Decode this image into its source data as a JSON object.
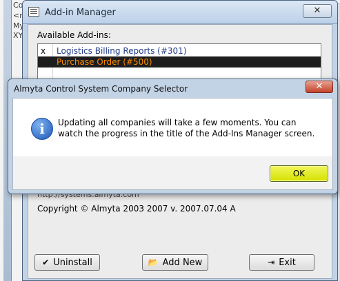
{
  "background_window": {
    "lines": [
      "Co",
      "<n",
      "My",
      "XY"
    ]
  },
  "addin_manager": {
    "title": "Add-in Manager",
    "close_glyph": "✕",
    "available_label": "Available Add-ins:",
    "addins": [
      {
        "checked": "x",
        "name": "Logistics Billing Reports (#301)",
        "selected": false
      },
      {
        "checked": "",
        "name": "Purchase Order (#500)",
        "selected": true
      }
    ],
    "url_text": "http://systems.almyta.com",
    "copyright": "Copyright © Almyta 2003 2007 v. 2007.07.04 A",
    "buttons": {
      "uninstall": "Uninstall",
      "add_new": "Add New",
      "exit": "Exit"
    },
    "icons": {
      "uninstall": "check-icon",
      "add_new": "folder-icon",
      "exit": "exit-door-icon"
    }
  },
  "dialog": {
    "title": "Almyta Control System Company Selector",
    "close_glyph": "✕",
    "icon": "info-icon",
    "message": "Updating all companies will take a few moments. You can watch the progress in the title of the Add-Ins Manager screen.",
    "ok_label": "OK",
    "ok_color": "#d5e000"
  }
}
